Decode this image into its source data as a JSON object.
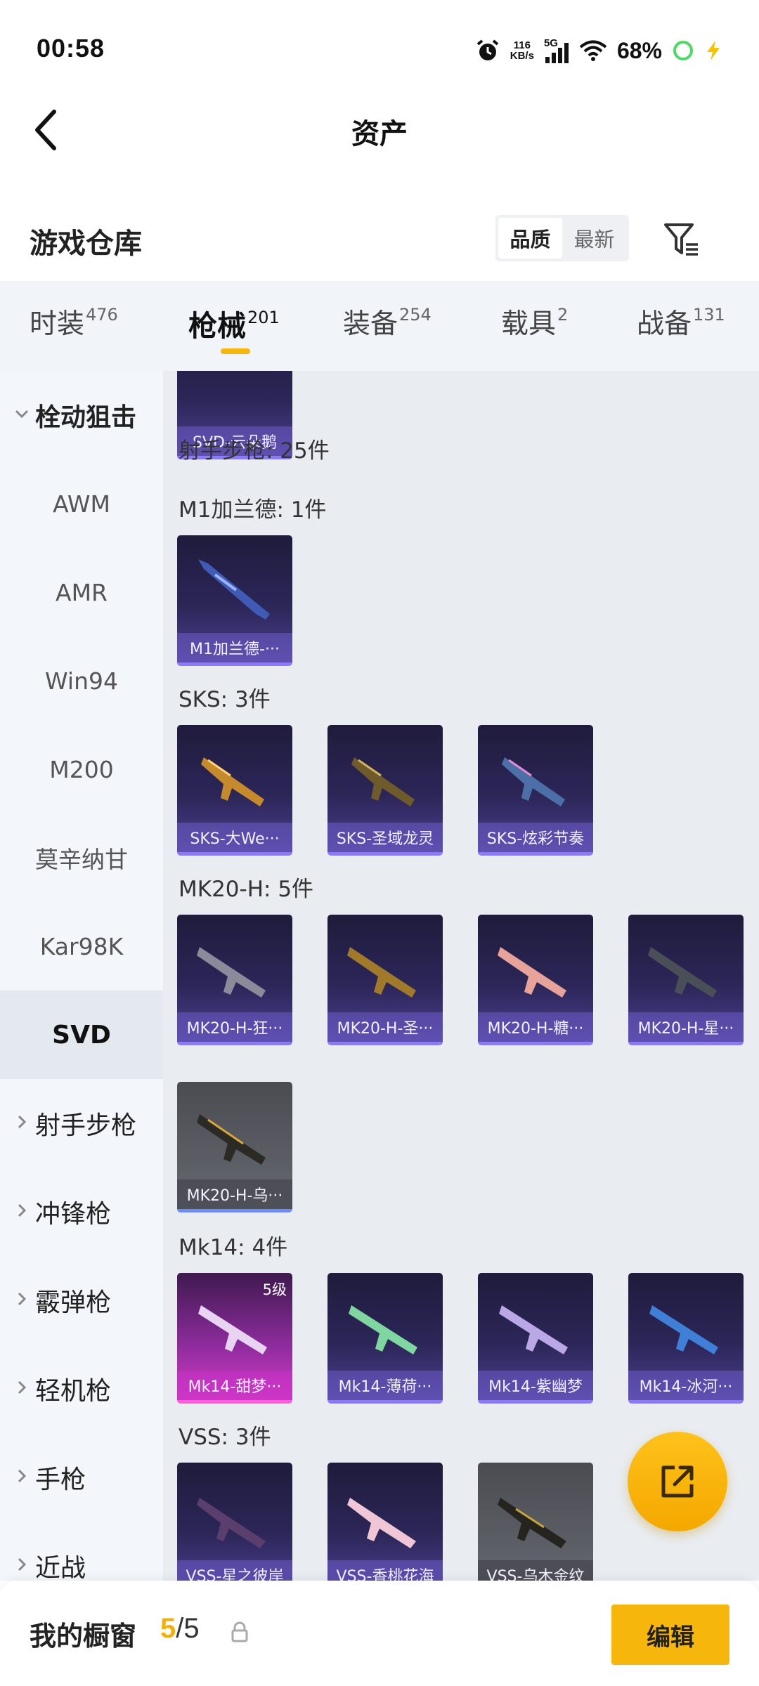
{
  "status_bar": {
    "time": "00:58",
    "net_speed_value": "116",
    "net_speed_unit": "KB/s",
    "network": "5G",
    "battery": "68%"
  },
  "header": {
    "title": "资产"
  },
  "warehouse": {
    "title": "游戏仓库",
    "sort_options": [
      "品质",
      "最新"
    ],
    "sort_selected": "品质"
  },
  "tabs": [
    {
      "label": "时装",
      "count": "476"
    },
    {
      "label": "枪械",
      "count": "201"
    },
    {
      "label": "装备",
      "count": "254"
    },
    {
      "label": "载具",
      "count": "2"
    },
    {
      "label": "战备",
      "count": "131"
    }
  ],
  "active_tab": "枪械",
  "sidebar": {
    "items": [
      {
        "label": "栓动狙击",
        "type": "group",
        "expanded": true
      },
      {
        "label": "AWM",
        "type": "sub"
      },
      {
        "label": "AMR",
        "type": "sub"
      },
      {
        "label": "Win94",
        "type": "sub"
      },
      {
        "label": "M200",
        "type": "sub"
      },
      {
        "label": "莫辛纳甘",
        "type": "sub"
      },
      {
        "label": "Kar98K",
        "type": "sub"
      },
      {
        "label": "SVD",
        "type": "sub",
        "selected": true
      },
      {
        "label": "射手步枪",
        "type": "group"
      },
      {
        "label": "冲锋枪",
        "type": "group"
      },
      {
        "label": "霰弹枪",
        "type": "group"
      },
      {
        "label": "轻机枪",
        "type": "group"
      },
      {
        "label": "手枪",
        "type": "group"
      },
      {
        "label": "近战",
        "type": "group"
      }
    ]
  },
  "content": {
    "top_partial_card": "SVD-云朵鹅",
    "category_header": "射手步枪: 25件",
    "sections": [
      {
        "title": "M1加兰德: 1件",
        "items": [
          {
            "label": "M1加兰德-···"
          }
        ]
      },
      {
        "title": "SKS: 3件",
        "items": [
          {
            "label": "SKS-大We···"
          },
          {
            "label": "SKS-圣域龙灵"
          },
          {
            "label": "SKS-炫彩节奏"
          }
        ]
      },
      {
        "title": "MK20-H: 5件",
        "items": [
          {
            "label": "MK20-H-狂···"
          },
          {
            "label": "MK20-H-圣···"
          },
          {
            "label": "MK20-H-糖···"
          },
          {
            "label": "MK20-H-星···"
          },
          {
            "label": "MK20-H-乌···"
          }
        ]
      },
      {
        "title": "Mk14: 4件",
        "items": [
          {
            "label": "Mk14-甜梦···",
            "level": "5级"
          },
          {
            "label": "Mk14-薄荷···"
          },
          {
            "label": "Mk14-紫幽梦"
          },
          {
            "label": "Mk14-冰河···"
          }
        ]
      },
      {
        "title": "VSS: 3件",
        "items": [
          {
            "label": "VSS-星之彼岸"
          },
          {
            "label": "VSS-香桃花海"
          },
          {
            "label": "VSS-乌木金纹"
          }
        ]
      }
    ]
  },
  "bottom_bar": {
    "label": "我的橱窗",
    "current": "5",
    "separator": "/",
    "total": "5",
    "edit_label": "编辑"
  },
  "colors": {
    "accent": "#f6b60b",
    "card_purple": "#2c2658",
    "card_gray": "#5a5d63",
    "card_pink": "#d23cc4"
  }
}
